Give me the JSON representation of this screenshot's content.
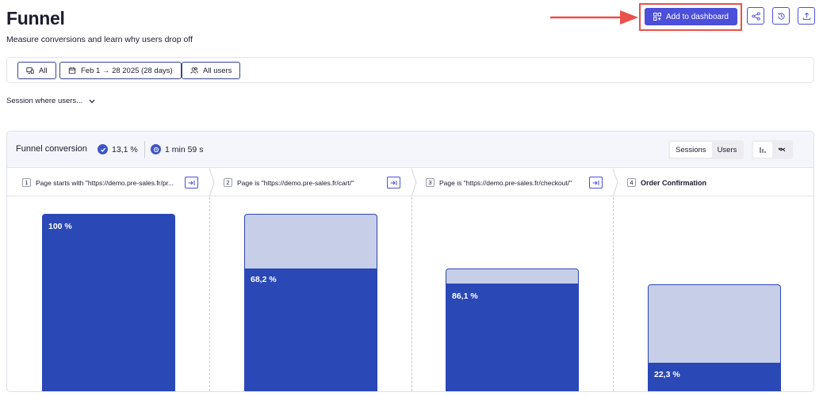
{
  "header": {
    "title": "Funnel",
    "subtitle": "Measure conversions and learn why users drop off",
    "add_to_dashboard_label": "Add to dashboard"
  },
  "filters": {
    "device_label": "All",
    "date_label": "Feb 1 → 28 2025 (28 days)",
    "segment_label": "All users"
  },
  "session_select": {
    "label": "Session where users..."
  },
  "panel": {
    "title": "Funnel conversion",
    "conversion_rate": "13,1 %",
    "avg_duration": "1 min 59 s",
    "view_toggle": [
      "Sessions",
      "Users"
    ],
    "active_view": "Sessions"
  },
  "steps": [
    {
      "number": "1",
      "label": "Page starts with \"https://demo.pre-sales.fr/pr...",
      "conversion_label": "100 %"
    },
    {
      "number": "2",
      "label": "Page is \"https://demo.pre-sales.fr/cart/\"",
      "conversion_label": "68,2 %"
    },
    {
      "number": "3",
      "label": "Page is \"https://demo.pre-sales.fr/checkout/\"",
      "conversion_label": "86,1 %"
    },
    {
      "number": "4",
      "label": "Order Confirmation",
      "conversion_label": "22,3 %"
    }
  ],
  "colors": {
    "accent": "#4b4fd9",
    "bar_converted": "#2a48b6",
    "bar_dropped": "#c7cfe8",
    "annotation": "#e9524a"
  },
  "icons": {
    "add_button": "dashboard-grid-icon",
    "share": "share-icon",
    "history": "history-icon",
    "export": "upload-icon",
    "device": "devices-icon",
    "date": "calendar-icon",
    "segment": "users-icon",
    "conversion": "check-circle-icon",
    "duration": "clock-icon"
  }
}
